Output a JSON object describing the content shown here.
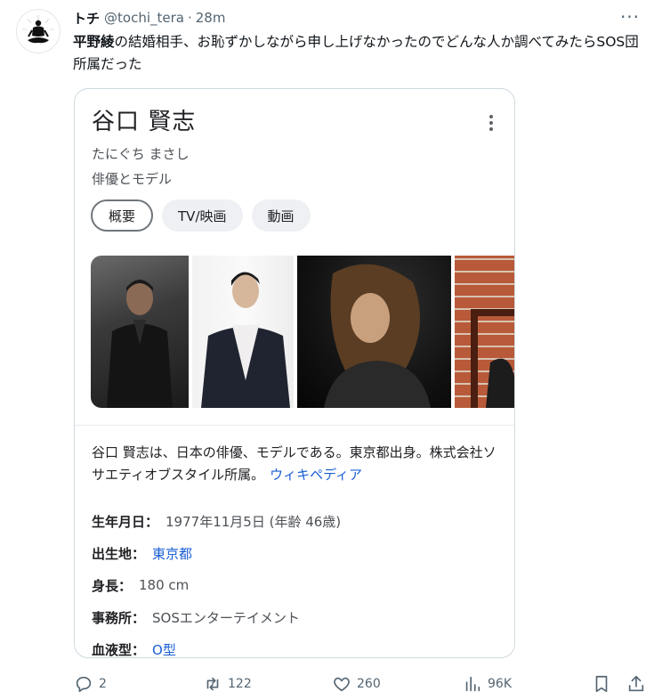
{
  "tweet": {
    "display_name": "トチ",
    "handle": "@tochi_tera",
    "separator": "·",
    "time": "28m",
    "text_bold": "平野綾",
    "text_rest": "の結婚相手、お恥ずかしながら申し上げなかったのでどんな人か調べてみたらSOS団所属だった"
  },
  "knowledge_panel": {
    "name": "谷口 賢志",
    "reading": "たにぐち まさし",
    "occupation": "俳優とモデル",
    "chips": [
      {
        "label": "概要",
        "active": true
      },
      {
        "label": "TV/映画",
        "active": false
      },
      {
        "label": "動画",
        "active": false
      }
    ],
    "description": "谷口 賢志は、日本の俳優、モデルである。東京都出身。株式会社ソサエティオブスタイル所属。",
    "source_link": "ウィキペディア",
    "facts": [
      {
        "label": "生年月日：",
        "value": "1977年11月5日 (年齢 46歳)",
        "link": false
      },
      {
        "label": "出生地：",
        "value": "東京都",
        "link": true
      },
      {
        "label": "身長：",
        "value": "180 cm",
        "link": false
      },
      {
        "label": "事務所：",
        "value": "SOSエンターテイメント",
        "link": false
      },
      {
        "label": "血液型：",
        "value": "O型",
        "link": true
      }
    ]
  },
  "actions": {
    "replies": "2",
    "retweets": "122",
    "likes": "260",
    "views": "96K"
  },
  "colors": {
    "link": "#1a5fd4",
    "muted": "#536471",
    "border": "#cfd9de"
  }
}
